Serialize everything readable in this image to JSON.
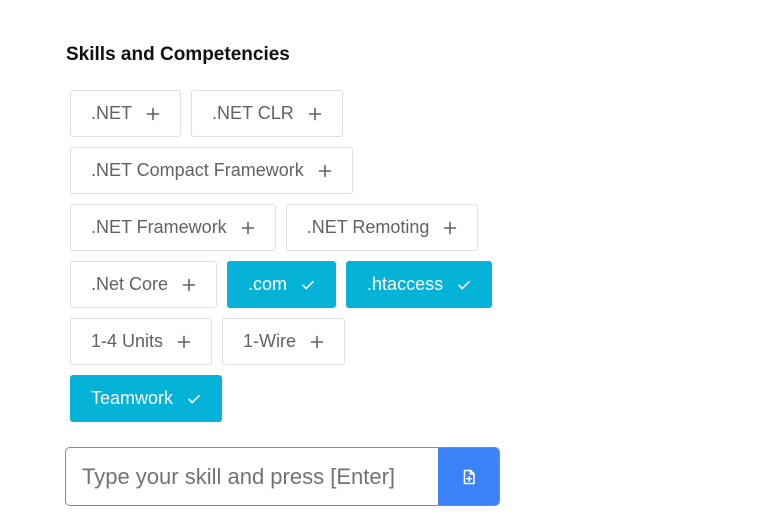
{
  "section": {
    "title": "Skills and Competencies"
  },
  "skills": [
    {
      "label": ".NET",
      "selected": false
    },
    {
      "label": ".NET CLR",
      "selected": false
    },
    {
      "label": ".NET Compact Framework",
      "selected": false
    },
    {
      "label": ".NET Framework",
      "selected": false
    },
    {
      "label": ".NET Remoting",
      "selected": false
    },
    {
      "label": ".Net Core",
      "selected": false
    },
    {
      "label": ".com",
      "selected": true
    },
    {
      "label": ".htaccess",
      "selected": true
    },
    {
      "label": "1-4 Units",
      "selected": false
    },
    {
      "label": "1-Wire",
      "selected": false
    },
    {
      "label": "Teamwork",
      "selected": true
    }
  ],
  "input": {
    "placeholder": "Type your skill and press [Enter]",
    "value": ""
  },
  "add_button": {
    "icon": "file-plus-icon"
  },
  "colors": {
    "selected_chip": "#04b3d7",
    "add_button": "#3b82f6",
    "chip_border": "#dedede"
  }
}
